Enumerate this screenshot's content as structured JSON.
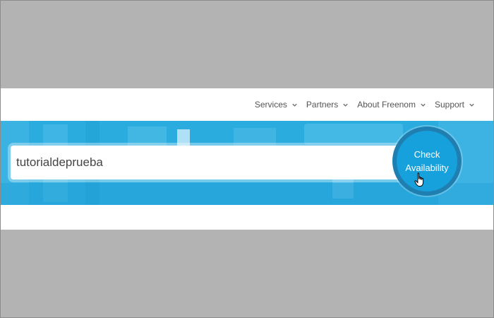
{
  "nav": {
    "items": [
      {
        "label": "Services"
      },
      {
        "label": "Partners"
      },
      {
        "label": "About Freenom"
      },
      {
        "label": "Support"
      }
    ]
  },
  "search": {
    "value": "tutorialdeprueba"
  },
  "check_button": {
    "line1": "Check",
    "line2": "Availability"
  },
  "colors": {
    "hero": "#2bacdf",
    "button": "#16a1dc",
    "button_ring": "#1e7fb0"
  },
  "icons": [
    "chevron-down-icon",
    "hand-cursor-icon"
  ]
}
